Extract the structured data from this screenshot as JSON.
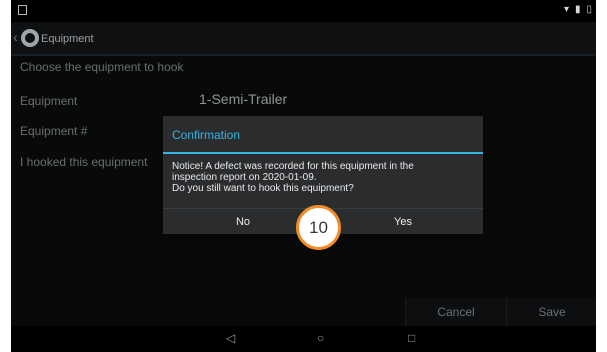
{
  "appbar": {
    "title": "Equipment"
  },
  "form": {
    "heading": "Choose the equipment to hook",
    "rows": [
      {
        "label": "Equipment",
        "value": "1-Semi-Trailer"
      },
      {
        "label": "Equipment #",
        "value": ""
      },
      {
        "label": "I hooked this equipment",
        "value": ""
      }
    ]
  },
  "bottom_actions": {
    "cancel": "Cancel",
    "save": "Save"
  },
  "dialog": {
    "title": "Confirmation",
    "message": "Notice! A defect was recorded for this equipment in the\ninspection report on 2020-01-09.\nDo you still want to hook this equipment?",
    "no": "No",
    "yes": "Yes"
  },
  "step_badge": "10",
  "navbar": {
    "back": "◁",
    "home": "○",
    "recent": "□"
  },
  "colors": {
    "accent": "#33b5e5",
    "badge_ring": "#f28c28"
  }
}
